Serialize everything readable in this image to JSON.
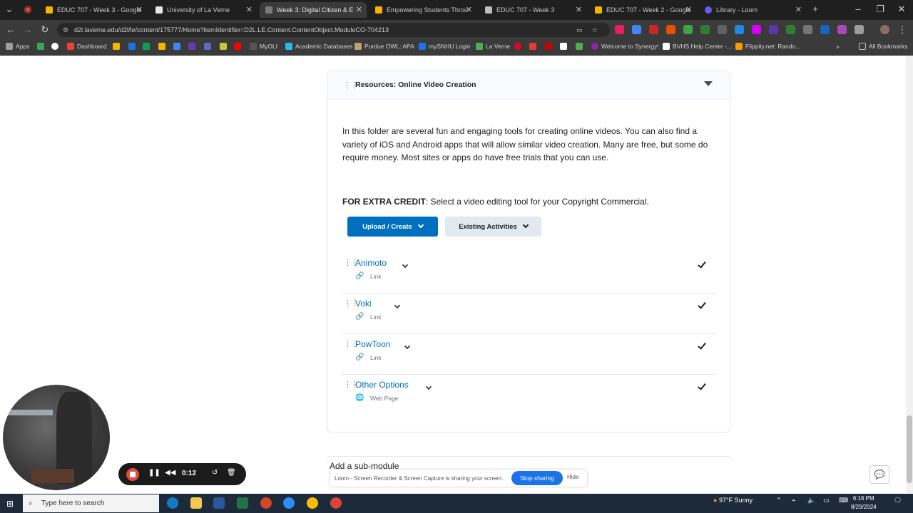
{
  "browser": {
    "tabs": [
      {
        "label": "EDUC 707 - Week 3 - Google",
        "color": "#f4b400"
      },
      {
        "label": "University of La Verne",
        "color": "#e8e8e8"
      },
      {
        "label": "Week 3: Digital Citizen & E",
        "color": "#7a7a7a"
      },
      {
        "label": "Empowering Students Throu",
        "color": "#f4b400"
      },
      {
        "label": "EDUC 707 - Week 3",
        "color": "#bdbdbd"
      },
      {
        "label": "EDUC 707 - Week 2 - Google",
        "color": "#f4b400"
      },
      {
        "label": "Library - Loom",
        "color": "#625df5"
      }
    ],
    "url": "d2l.laverne.edu/d2l/le/content/175777/Home?itemIdentifier=D2L.LE.Content.ContentObject.ModuleCO-704213",
    "bookmarks": [
      {
        "label": "Apps",
        "color": "#9e9e9e"
      },
      {
        "label": "",
        "color": "#34a853"
      },
      {
        "label": "",
        "color": "#ffffff"
      },
      {
        "label": "Dashboard",
        "color": "#ea4335"
      },
      {
        "label": "",
        "color": "#f4b400"
      },
      {
        "label": "",
        "color": "#1a73e8"
      },
      {
        "label": "",
        "color": "#0f9d58"
      },
      {
        "label": "",
        "color": "#f4b400"
      },
      {
        "label": "",
        "color": "#4285f4"
      },
      {
        "label": "",
        "color": "#673ab7"
      },
      {
        "label": "",
        "color": "#5c6bc0"
      },
      {
        "label": "",
        "color": "#c0ca33"
      },
      {
        "label": "",
        "color": "#ff0000"
      },
      {
        "label": "MyOLI",
        "color": "#555555"
      },
      {
        "label": "Academic Databases",
        "color": "#29b6f6"
      },
      {
        "label": "Purdue OWL: APA",
        "color": "#bfa26a"
      },
      {
        "label": "mySNHU Login",
        "color": "#1a73e8"
      },
      {
        "label": "La Verne",
        "color": "#4caf50"
      },
      {
        "label": "",
        "color": "#e60023"
      },
      {
        "label": "",
        "color": "#e53935"
      },
      {
        "label": "",
        "color": "#cc0000"
      },
      {
        "label": "",
        "color": "#ffffff"
      },
      {
        "label": "",
        "color": "#4caf50"
      },
      {
        "label": "Welcome to Synergy!",
        "color": "#8e24aa"
      },
      {
        "label": "BVHS Help Center -...",
        "color": "#ffffff"
      },
      {
        "label": "Flippity.net: Rando...",
        "color": "#ff9800"
      },
      {
        "label": "All Bookmarks",
        "color": "#bdbdbd"
      }
    ]
  },
  "module": {
    "title": "Resources: Online Video Creation",
    "description": "In this folder are several fun and engaging tools for creating online videos. You can also find a variety of iOS and Android apps that will allow similar video creation. Many are free, but some do require money. Most sites or apps do have free trials that you can use.",
    "extra_label": "FOR EXTRA CREDIT",
    "extra_text": ": Select a video editing tool for your Copyright Commercial.",
    "upload_label": "Upload / Create",
    "existing_label": "Existing Activities",
    "items": [
      {
        "title": "Animoto",
        "type": "Link"
      },
      {
        "title": "Voki",
        "type": "Link"
      },
      {
        "title": "PowToon",
        "type": "Link"
      },
      {
        "title": "Other Options",
        "type": "Web Page"
      }
    ],
    "submodule_label": "Add a sub-module"
  },
  "share_bar": {
    "text": "Loom - Screen Recorder & Screen Capture is sharing your screen.",
    "stop_label": "Stop sharing",
    "hide_label": "Hide"
  },
  "recorder": {
    "time": "0:12"
  },
  "taskbar": {
    "search_placeholder": "Type here to search",
    "weather": "97°F  Sunny",
    "time": "6:16 PM",
    "date": "8/29/2024"
  },
  "colors": {
    "accent": "#006fbf",
    "record": "#e54b3c"
  }
}
